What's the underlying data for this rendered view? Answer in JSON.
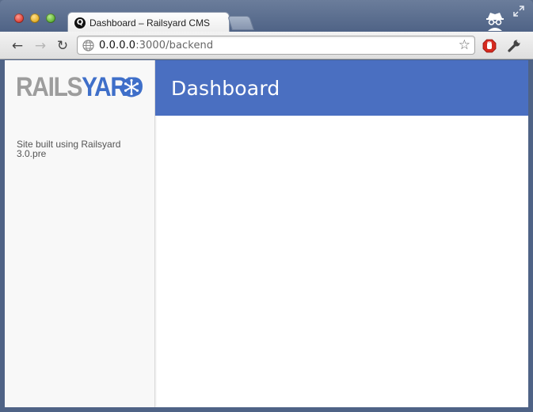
{
  "browser": {
    "tab": {
      "title": "Dashboard – Railsyard CMS",
      "favicon": "railsyard-q-icon"
    },
    "address": {
      "host": "0.0.0.0",
      "rest": ":3000/backend"
    },
    "icons": {
      "back": "back-arrow-icon",
      "forward": "forward-arrow-icon",
      "reload": "reload-icon",
      "star": "bookmark-star-icon",
      "extension": "stop-hand-icon",
      "wrench": "wrench-icon",
      "incognito": "incognito-icon",
      "fullscreen": "fullscreen-icon"
    },
    "glyphs": {
      "back": "←",
      "forward": "→",
      "reload": "↻",
      "star": "☆",
      "favicon": "Q"
    }
  },
  "sidebar": {
    "logo": {
      "part1": "RAILS",
      "part2": "YARD"
    },
    "site_info": "Site built using Railsyard 3.0.pre"
  },
  "header": {
    "title": "Dashboard"
  },
  "colors": {
    "header_bg": "#4a6fc1",
    "logo_grey": "#9d9d9d",
    "logo_blue": "#3f6fc9",
    "sidebar_bg": "#f8f8f8"
  }
}
